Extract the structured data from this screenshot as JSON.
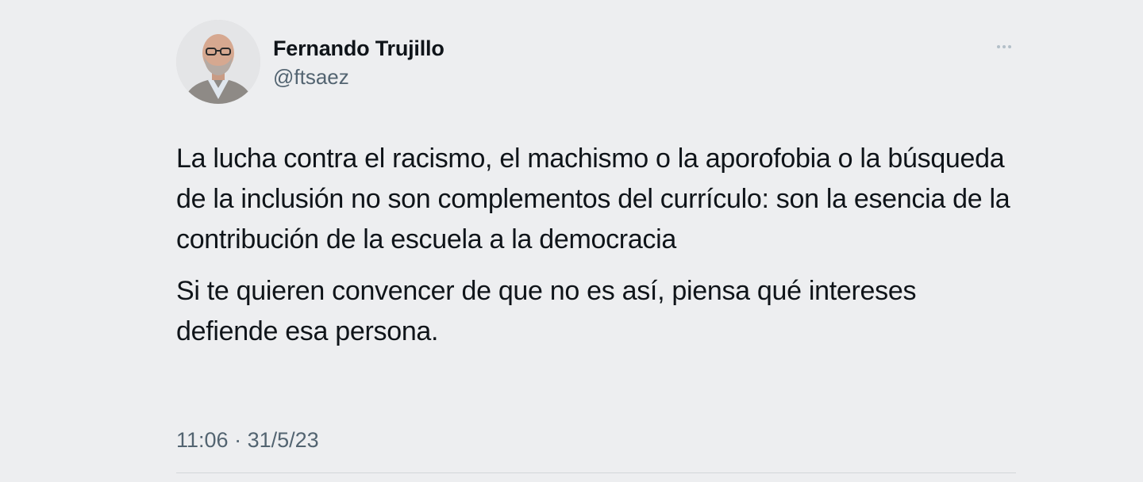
{
  "author": {
    "name": "Fernando Trujillo",
    "handle": "@ftsaez",
    "avatar_icon": "profile-photo"
  },
  "tweet": {
    "paragraphs": [
      "La lucha contra el racismo, el machismo o la aporofobia o la búsqueda de la inclusión no son complementos del currículo: son la esencia de la contribución de la escuela a la democracia",
      "Si te quieren convencer de que no es así, piensa qué intereses defiende esa persona."
    ],
    "time": "11:06",
    "separator": "·",
    "date": "31/5/23"
  },
  "colors": {
    "background": "#edeef0",
    "text": "#0f1419",
    "secondary_text": "#536471"
  },
  "icons": {
    "more": "more-horizontal-icon"
  }
}
